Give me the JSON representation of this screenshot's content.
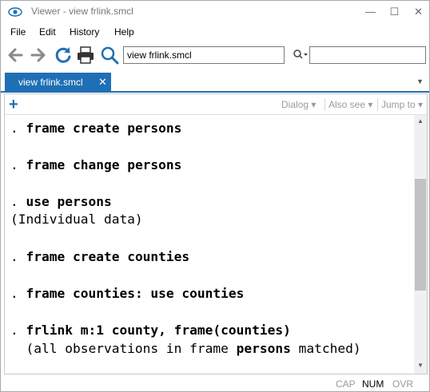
{
  "window": {
    "title": "Viewer - view frlink.smcl",
    "minimize": "—",
    "maximize": "☐",
    "close": "✕"
  },
  "menu": {
    "file": "File",
    "edit": "Edit",
    "history": "History",
    "help": "Help"
  },
  "toolbar": {
    "command_value": "view frlink.smcl",
    "find_value": ""
  },
  "tab": {
    "label": "view frlink.smcl",
    "close": "✕",
    "dropdown": "▼"
  },
  "results_toolbar": {
    "add": "+",
    "dialog": "Dialog ▾",
    "also_see": "Also see ▾",
    "jump_to": "Jump to ▾"
  },
  "output": {
    "lines": [
      {
        "dot": ". ",
        "cmd": "frame create persons",
        "rest": ""
      },
      {
        "dot": ". ",
        "cmd": "frame change persons",
        "rest": ""
      },
      {
        "dot": ". ",
        "cmd": "use persons",
        "rest": ""
      },
      {
        "plain": "(Individual data)"
      },
      {
        "dot": ". ",
        "cmd": "frame create counties",
        "rest": ""
      },
      {
        "dot": ". ",
        "cmd": "frame counties: use counties",
        "rest": ""
      },
      {
        "dot": ". ",
        "cmd": "frlink m:1 county, frame(counties)",
        "rest": ""
      },
      {
        "pre": "  (all observations in frame ",
        "bold": "persons",
        "post": " matched)"
      }
    ]
  },
  "status": {
    "cap": "CAP",
    "num": "NUM",
    "ovr": "OVR"
  },
  "colors": {
    "accent": "#1f6fb5",
    "toolbar_icon": "#8a8a8a"
  }
}
